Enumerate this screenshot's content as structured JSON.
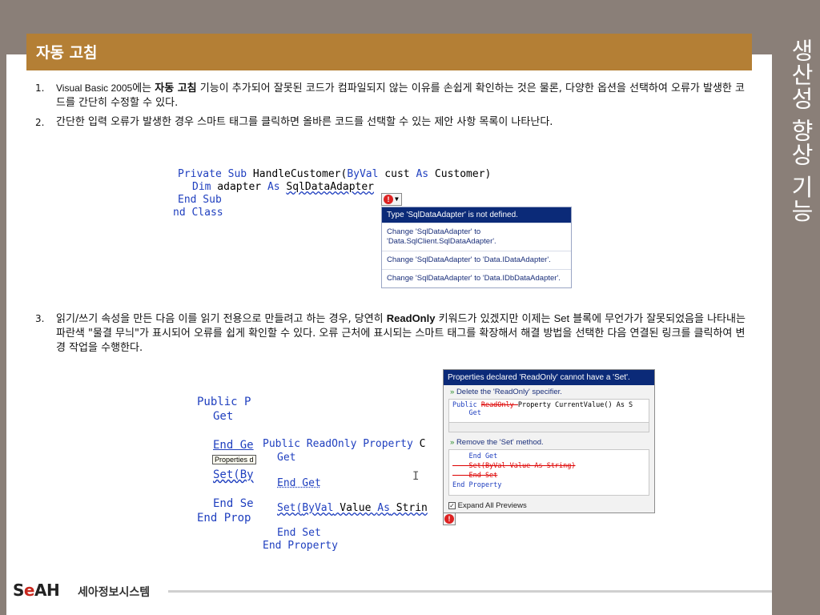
{
  "slide": {
    "title": "자동 고침",
    "side_title": "생산성 향상 기능"
  },
  "items": [
    {
      "num": "1.",
      "parts": {
        "a": "Visual Basic 2005",
        "b": "에는 ",
        "c": "자동 고침",
        "d": " 기능이 추가되어 잘못된 코드가 컴파일되지 않는 이유를 손쉽게 확인하는 것은 물론, 다양한 옵션을 선택하여 오류가 발생한 코드를 간단히 수정할 수 있다."
      }
    },
    {
      "num": "2.",
      "text": "간단한 입력 오류가 발생한 경우 스마트 태그를 클릭하면 올바른 코드를 선택할 수 있는 제안 사항 목록이 나타난다."
    },
    {
      "num": "3.",
      "parts": {
        "a": "읽기/쓰기 속성을 만든 다음 이를 읽기 전용으로 만들려고 하는 경우, 당연히 ",
        "b": "ReadOnly",
        "c": " 키워드가 있겠지만 이제는 ",
        "d": "Set",
        "e": " 블록에 무언가가 잘못되었음을 나타내는 파란색 \"물결 무늬\"가 표시되어 오류를 쉽게 확인할 수 있다. 오류 근처에 표시되는 스마트 태그를 확장해서 해결 방법을 선택한 다음 연결된 링크를 클릭하여 변경 작업을 수행한다."
      }
    }
  ],
  "shot1": {
    "line1_kw1": "Private Sub",
    "line1_rest": " HandleCustomer(",
    "line1_kw2": "ByVal",
    "line1_rest2": " cust ",
    "line1_kw3": "As",
    "line1_rest3": " Customer)",
    "line2_kw1": "Dim",
    "line2_rest": " adapter ",
    "line2_kw2": "As",
    "line2_type": "SqlDataAdapter",
    "line3": "End Sub",
    "line4": "nd Class",
    "error_icon": "!",
    "suggest_head": "Type 'SqlDataAdapter' is not defined.",
    "suggestions": [
      "Change 'SqlDataAdapter' to 'Data.SqlClient.SqlDataAdapter'.",
      "Change 'SqlDataAdapter' to 'Data.IDataAdapter'.",
      "Change 'SqlDataAdapter' to 'Data.IDbDataAdapter'."
    ]
  },
  "shot2": {
    "back_line1": "Public P",
    "back_line2": "Get",
    "back_line3": "End Ge",
    "back_tip": "Properties d",
    "back_line4": "Set(By",
    "back_line5": "End Se",
    "back_line6": "End Prop",
    "front_line1_kw": "Public ReadOnly Property",
    "front_line1_rest": " C",
    "front_line2": "Get",
    "front_line3": "End Get",
    "front_line4_a": "Set(",
    "front_line4_kw": "ByVal",
    "front_line4_b": " Value ",
    "front_line4_kw2": "As",
    "front_line4_c": " Strin",
    "front_line5": "End Set",
    "front_line6": "End Property",
    "cursor": "I",
    "error_icon": "!"
  },
  "panel": {
    "head": "Properties declared 'ReadOnly' cannot have a 'Set'.",
    "opt1": "Delete the 'ReadOnly' specifier.",
    "preview1_a": "Public ",
    "preview1_strike": "ReadOnly ",
    "preview1_b": "Property CurrentValue() As S",
    "preview1_c": "    Get",
    "opt2": "Remove the 'Set' method.",
    "preview2_a": "    End Get",
    "preview2_b": "    Set(ByVal Value As String)",
    "preview2_c": "    End Set",
    "preview2_d": "End Property",
    "expand": "Expand All Previews",
    "arrow_icon": "»"
  },
  "footer": {
    "logo_a": "S",
    "logo_b": "e",
    "logo_c": "AH",
    "logo_ko": "세아정보시스템"
  }
}
